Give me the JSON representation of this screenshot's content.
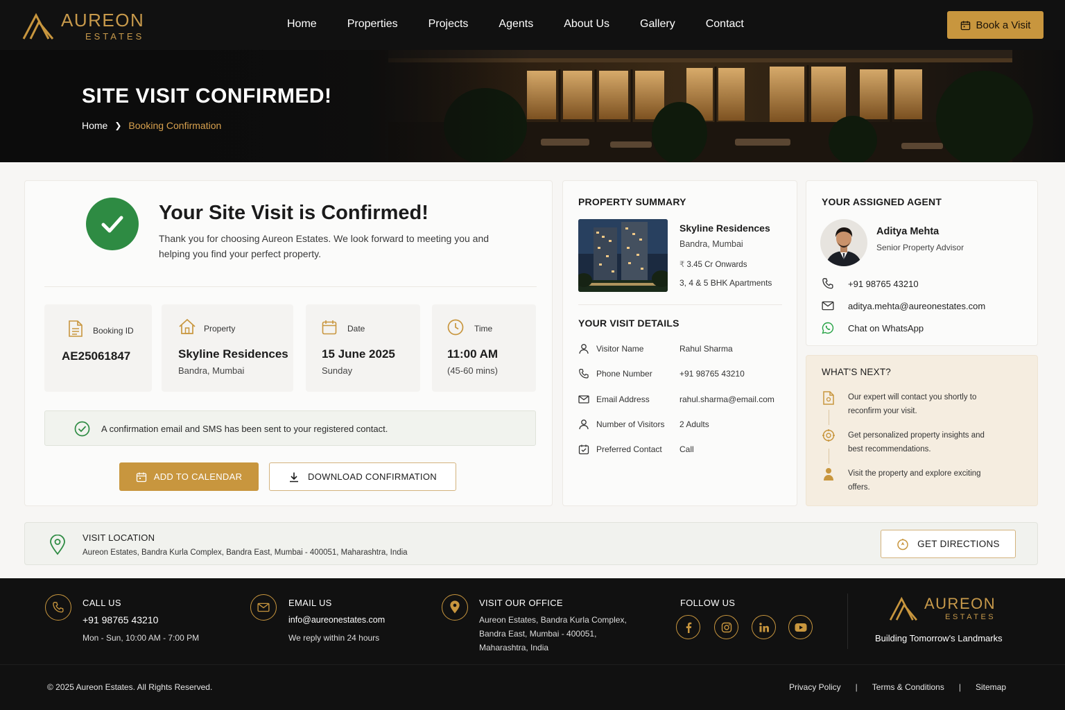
{
  "brand": {
    "name": "AUREON",
    "sub": "ESTATES",
    "tagline": "Building Tomorrow's Landmarks",
    "accent": "#c8963e"
  },
  "nav": {
    "links": [
      "Home",
      "Properties",
      "Projects",
      "Agents",
      "About Us",
      "Gallery",
      "Contact"
    ],
    "cta": "Book a Visit"
  },
  "hero": {
    "title": "SITE VISIT CONFIRMED!",
    "breadcrumb": {
      "home": "Home",
      "current": "Booking Confirmation"
    }
  },
  "confirmation": {
    "title": "Your Site Visit is Confirmed!",
    "message": "Thank you for choosing Aureon Estates. We look forward to meeting you and helping you find your perfect property.",
    "booking": {
      "label": "Booking ID",
      "value": "AE25061847"
    },
    "property": {
      "label": "Property",
      "value": "Skyline Residences",
      "sub": "Bandra, Mumbai"
    },
    "date": {
      "label": "Date",
      "value": "15 June 2025",
      "sub": "Sunday"
    },
    "time": {
      "label": "Time",
      "value": "11:00 AM",
      "sub": "(45-60 mins)"
    },
    "notice": "A confirmation email and SMS has been sent to your registered contact.",
    "add_calendar": "ADD TO CALENDAR",
    "download": "DOWNLOAD CONFIRMATION"
  },
  "property_summary": {
    "heading": "PROPERTY SUMMARY",
    "name": "Skyline Residences",
    "location": "Bandra, Mumbai",
    "currency": "₹",
    "price": "3.45 Cr Onwards",
    "type": "3, 4 & 5 BHK Apartments"
  },
  "visit_details": {
    "heading": "YOUR VISIT DETAILS",
    "rows": [
      {
        "label": "Visitor Name",
        "value": "Rahul Sharma",
        "icon": "user-icon"
      },
      {
        "label": "Phone Number",
        "value": "+91 98765 43210",
        "icon": "phone-icon"
      },
      {
        "label": "Email Address",
        "value": "rahul.sharma@email.com",
        "icon": "mail-icon"
      },
      {
        "label": "Number of Visitors",
        "value": "2 Adults",
        "icon": "users-icon"
      },
      {
        "label": "Preferred Contact",
        "value": "Call",
        "icon": "contact-icon"
      }
    ]
  },
  "agent": {
    "heading": "YOUR ASSIGNED AGENT",
    "name": "Aditya Mehta",
    "role": "Senior Property Advisor",
    "phone": "+91 98765 43210",
    "email": "aditya.mehta@aureonestates.com",
    "whatsapp": "Chat on WhatsApp",
    "whatsapp_color": "#25a244"
  },
  "next_steps": {
    "heading": "WHAT'S NEXT?",
    "items": [
      "Our expert will contact you shortly to reconfirm your visit.",
      "Get personalized property insights and best recommendations.",
      "Visit the property and explore exciting offers."
    ]
  },
  "location": {
    "title": "VISIT LOCATION",
    "address": "Aureon Estates, Bandra Kurla Complex, Bandra East, Mumbai - 400051, Maharashtra, India",
    "directions": "GET DIRECTIONS"
  },
  "footer": {
    "call": {
      "title": "CALL US",
      "value": "+91 98765 43210",
      "sub": "Mon - Sun, 10:00 AM - 7:00 PM"
    },
    "email": {
      "title": "EMAIL US",
      "value": "info@aureonestates.com",
      "sub": "We reply within 24 hours"
    },
    "office": {
      "title": "VISIT OUR OFFICE",
      "lines": [
        "Aureon Estates, Bandra Kurla Complex,",
        "Bandra East, Mumbai - 400051,",
        "Maharashtra, India"
      ]
    },
    "follow": {
      "title": "FOLLOW US",
      "networks": [
        "facebook-icon",
        "instagram-icon",
        "linkedin-icon",
        "youtube-icon"
      ]
    },
    "copyright": "© 2025 Aureon Estates. All Rights Reserved.",
    "links": [
      "Privacy Policy",
      "Terms & Conditions",
      "Sitemap"
    ]
  },
  "colors": {
    "success": "#2e8b43",
    "nav_bg": "#111111",
    "accent": "#c8963e",
    "breadcrumb_active": "#d8a14e"
  }
}
